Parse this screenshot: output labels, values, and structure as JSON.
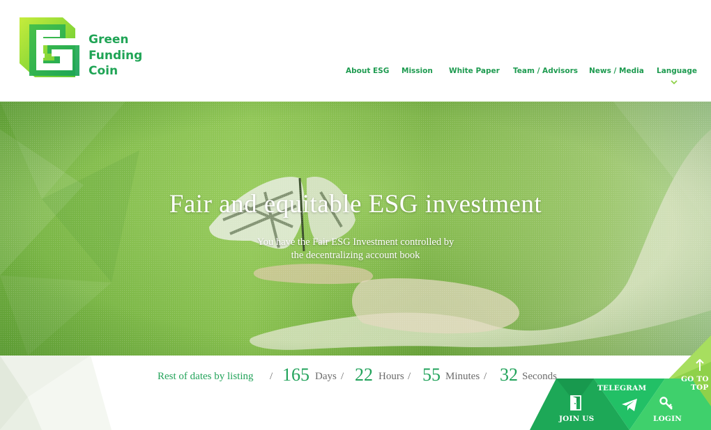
{
  "brand": {
    "lines": [
      "Green",
      "Funding",
      "Coin"
    ],
    "colors": {
      "primary": "#1fa455",
      "light": "#8fd14a",
      "accent": "#3ed16a"
    }
  },
  "nav": {
    "items": [
      "About ESG",
      "Mission",
      "White Paper",
      "Team / Advisors",
      "News / Media",
      "Language"
    ]
  },
  "hero": {
    "title": "Fair and equitable ESG investment",
    "subtitle_lines": [
      "You have the Fair ESG Investment controlled by",
      "the decentralizing account book"
    ]
  },
  "countdown": {
    "label": "Rest of dates by listing",
    "days": {
      "value": "165",
      "unit": "Days"
    },
    "hours": {
      "value": "22",
      "unit": "Hours"
    },
    "minutes": {
      "value": "55",
      "unit": "Minutes"
    },
    "seconds": {
      "value": "32",
      "unit": "Seconds"
    },
    "separator": "/"
  },
  "floating": {
    "join": "JOIN US",
    "telegram": "TELEGRAM",
    "login": "LOGIN",
    "top_lines": [
      "GO TO",
      "TOP"
    ]
  },
  "icons": [
    "logo-g-icon",
    "chevron-down-icon",
    "door-icon",
    "telegram-icon",
    "key-icon",
    "arrow-up-icon"
  ]
}
